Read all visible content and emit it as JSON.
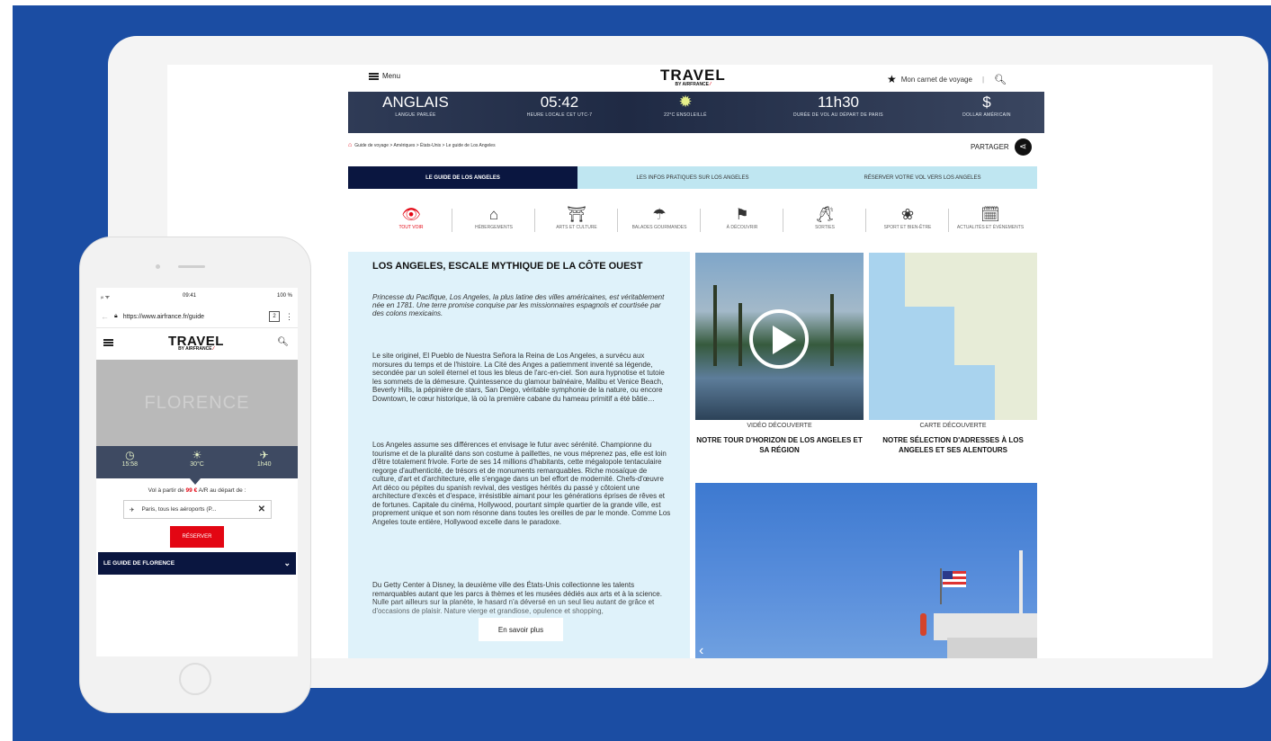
{
  "site": {
    "menu_label": "Menu",
    "logo_main": "TRAVEL",
    "logo_by": "BY AIRFRANCE",
    "carnet_label": "Mon carnet de voyage",
    "share_label": "PARTAGER"
  },
  "banner": [
    {
      "value": "ANGLAIS",
      "label": "LANGUE PARLÉE"
    },
    {
      "value": "05:42",
      "label": "HEURE LOCALE CET UTC-7"
    },
    {
      "value": "",
      "label": "22°C ENSOLEILLÉ"
    },
    {
      "value": "11h30",
      "label": "DURÉE DE VOL AU DÉPART DE PARIS"
    },
    {
      "value": "$",
      "label": "DOLLAR AMÉRICAIN"
    }
  ],
  "breadcrumb": "Guide de voyage > Amériques > États-Unis > Le guide de Los Angeles",
  "tabs": {
    "guide": "LE GUIDE DE LOS ANGELES",
    "infos": "LES INFOS PRATIQUES SUR LOS ANGELES",
    "reserve": "RÉSERVER VOTRE VOL VERS LOS ANGELES"
  },
  "categories": [
    {
      "label": "TOUT VOIR",
      "icon": "eye-icon"
    },
    {
      "label": "HÉBERGEMENTS",
      "icon": "bed-icon"
    },
    {
      "label": "ARTS ET CULTURE",
      "icon": "monument-icon"
    },
    {
      "label": "BALADES GOURMANDES",
      "icon": "food-icon"
    },
    {
      "label": "À DÉCOUVRIR",
      "icon": "flag-icon"
    },
    {
      "label": "SORTIES",
      "icon": "glasses-icon"
    },
    {
      "label": "SPORT ET BIEN-ÊTRE",
      "icon": "lotus-icon"
    },
    {
      "label": "ACTUALITÉS ET ÉVÉNEMENTS",
      "icon": "calendar-icon"
    }
  ],
  "article": {
    "title": "LOS ANGELES, ESCALE MYTHIQUE DE LA CÔTE OUEST",
    "lead": "Princesse du Pacifique, Los Angeles, la plus latine des villes américaines, est véritablement née en 1781. Une terre promise conquise par les missionnaires espagnols et courtisée par des colons mexicains.",
    "p1": "Le site originel, El Pueblo de Nuestra Señora la Reina de Los Angeles, a survécu aux morsures du temps et de l'histoire. La Cité des Anges a patiemment inventé sa légende, secondée par un soleil éternel et tous les bleus de l'arc-en-ciel. Son aura hypnotise et tutoie les sommets de la démesure. Quintessence du glamour balnéaire, Malibu et Venice Beach, Beverly Hills, la pépinière de stars, San Diego, véritable symphonie de la nature, ou encore Downtown, le cœur historique, là où la première cabane du hameau primitif a été bâtie…",
    "p2": "Los Angeles assume ses différences et envisage le futur avec sérénité. Championne du tourisme et de la pluralité dans son costume à paillettes, ne vous méprenez pas, elle est loin d'être totalement frivole. Forte de ses 14 millions d'habitants, cette mégalopole tentaculaire regorge d'authenticité, de trésors et de monuments remarquables. Riche mosaïque de culture, d'art et d'architecture, elle s'engage dans un bel effort de modernité. Chefs-d'œuvre Art déco ou pépites du spanish revival, des vestiges hérités du passé y côtoient une architecture d'excès et d'espace, irrésistible aimant pour les générations éprises de rêves et de fortunes. Capitale du cinéma, Hollywood, pourtant simple quartier de la grande ville, est proprement unique et son nom résonne dans toutes les oreilles de par le monde. Comme Los Angeles toute entière, Hollywood excelle dans le paradoxe.",
    "p3": "Du Getty Center à Disney, la deuxième ville des États-Unis collectionne les talents remarquables autant que les parcs à thèmes et les musées dédiés aux arts et à la science. Nulle part ailleurs sur la planète, le hasard n'a déversé en un seul lieu autant de grâce et d'occasions de plaisir. Nature vierge et grandiose, opulence et shopping,",
    "more_label": "En savoir plus"
  },
  "cards": [
    {
      "kicker": "VIDÉO DÉCOUVERTE",
      "title": "NOTRE TOUR D'HORIZON DE LOS ANGELES ET SA RÉGION"
    },
    {
      "kicker": "CARTE DÉCOUVERTE",
      "title": "NOTRE SÉLECTION D'ADRESSES À LOS ANGELES ET SES ALENTOURS"
    }
  ],
  "phone": {
    "status_left": "ᵢₗₗ ᯤ",
    "status_time": "09:41",
    "status_right": "100 %",
    "url": "https://www.airfrance.fr/guide",
    "tab_count": "2",
    "city": "FLORENCE",
    "info": [
      {
        "icon": "clock-icon",
        "value": "15:58"
      },
      {
        "icon": "sun-cloud-icon",
        "value": "30°C"
      },
      {
        "icon": "plane-icon",
        "value": "1h40"
      }
    ],
    "price_prefix": "Vol à partir de ",
    "price": "99 €",
    "price_suffix": " A/R au départ de :",
    "airport": "Paris, tous les aéroports (P...",
    "book_label": "RÉSERVER",
    "guide_label": "LE GUIDE DE FLORENCE"
  }
}
